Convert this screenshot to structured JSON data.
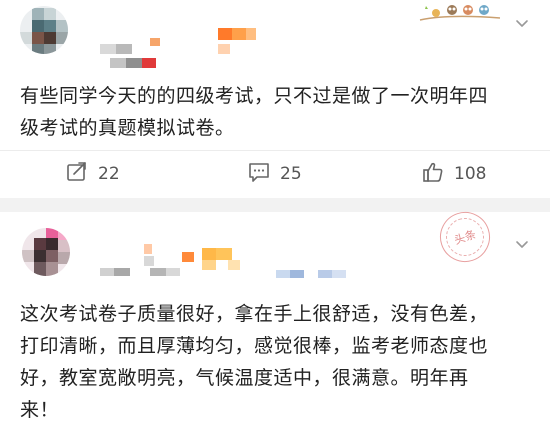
{
  "posts": [
    {
      "text": "有些同学今天的的四级考试，只不过是做了一次明年四级考试的真题模拟试卷。",
      "line1": "有些同学今天的的四级考试，只不过是做了一次明年四",
      "line2": "级考试的真题模拟试卷。",
      "actions": {
        "repost_count": "22",
        "comment_count": "25",
        "like_count": "108"
      }
    },
    {
      "text": "这次考试卷子质量很好，拿在手上很舒适，没有色差，打印清晰，而且厚薄均匀，感觉很棒，监考老师态度也好，教室宽敞明亮，气候温度适中，很满意。明年再来！",
      "line1": "这次考试卷子质量很好，拿在手上很舒适，没有色差，",
      "line2": "打印清晰，而且厚薄均匀，感觉很棒，监考老师态度也",
      "line3": "好，教室宽敞明亮，气候温度适中，很满意。明年再",
      "line4": "来！",
      "badge_text": "头条"
    }
  ],
  "icons": {
    "repost": "repost-icon",
    "comment": "comment-icon",
    "like": "thumbs-up-icon",
    "menu": "chevron-down-icon",
    "badge": "owl-badge-icon",
    "stamp": "headline-stamp-icon"
  },
  "colors": {
    "background": "#ffffff",
    "separator": "#f2f2f2",
    "text": "#222222",
    "count": "#555555",
    "icon": "#666666"
  }
}
